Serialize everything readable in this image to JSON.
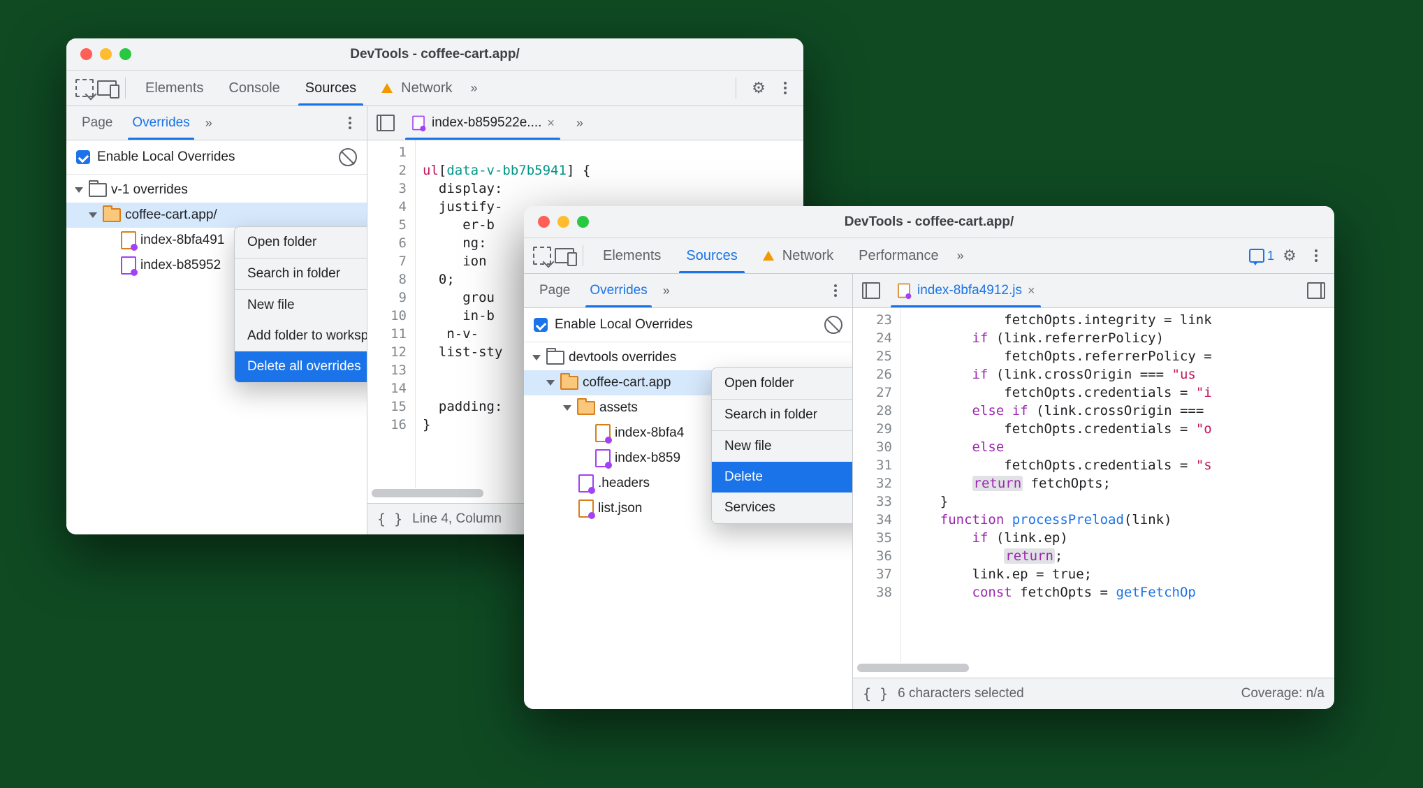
{
  "window1": {
    "title": "DevTools - coffee-cart.app/",
    "maintabs": {
      "elements": "Elements",
      "console": "Console",
      "sources": "Sources",
      "network": "Network"
    },
    "sidetabs": {
      "page": "Page",
      "overrides": "Overrides"
    },
    "overrides_label": "Enable Local Overrides",
    "tree": {
      "root": "v-1 overrides",
      "site": "coffee-cart.app/",
      "file1": "index-8bfa491",
      "file2": "index-b85952"
    },
    "file_tab": "index-b859522e....",
    "code_lines": [
      "",
      "ul[data-v-bb7b5941] {",
      "  display:",
      "  justify-",
      "     er-b",
      "     ng:",
      "     ion",
      "  0;",
      "     grou",
      "     in-b",
      "   n-v-",
      "  list-sty",
      "",
      "",
      "  padding:",
      "}"
    ],
    "status": "Line 4, Column",
    "ctxmenu": {
      "open_folder": "Open folder",
      "search_in_folder": "Search in folder",
      "new_file": "New file",
      "add_folder": "Add folder to workspace",
      "delete_all": "Delete all overrides"
    }
  },
  "window2": {
    "title": "DevTools - coffee-cart.app/",
    "maintabs": {
      "elements": "Elements",
      "sources": "Sources",
      "network": "Network",
      "performance": "Performance"
    },
    "msg_count": "1",
    "sidetabs": {
      "page": "Page",
      "overrides": "Overrides"
    },
    "overrides_label": "Enable Local Overrides",
    "tree": {
      "root": "devtools overrides",
      "site": "coffee-cart.app",
      "assets": "assets",
      "file1": "index-8bfa4",
      "file2": "index-b859",
      "headers": ".headers",
      "list": "list.json"
    },
    "file_tab": "index-8bfa4912.js",
    "code_start": 23,
    "code_lines": [
      "            fetchOpts.integrity = link",
      "        if (link.referrerPolicy)",
      "            fetchOpts.referrerPolicy = ",
      "        if (link.crossOrigin === \"us",
      "            fetchOpts.credentials = \"i",
      "        else if (link.crossOrigin ===",
      "            fetchOpts.credentials = \"o",
      "        else",
      "            fetchOpts.credentials = \"s",
      "        return fetchOpts;",
      "    }",
      "    function processPreload(link) ",
      "        if (link.ep)",
      "            return;",
      "        link.ep = true;",
      "        const fetchOpts = getFetchOp"
    ],
    "status_left": "6 characters selected",
    "status_right": "Coverage: n/a",
    "ctxmenu": {
      "open_folder": "Open folder",
      "search_in_folder": "Search in folder",
      "new_file": "New file",
      "delete": "Delete",
      "services": "Services"
    }
  }
}
